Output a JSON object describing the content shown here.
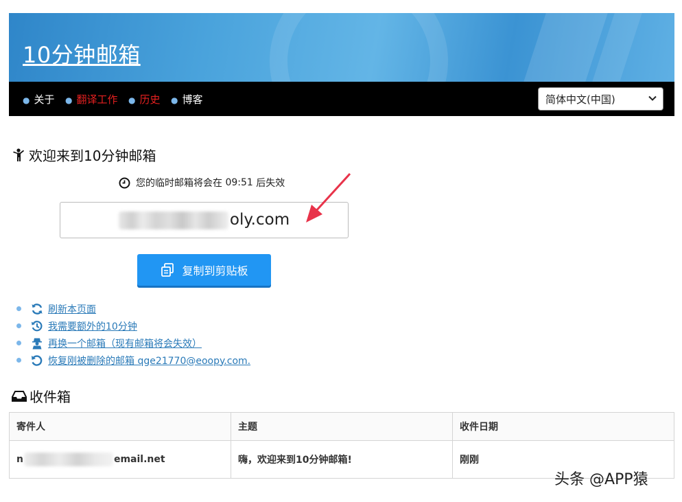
{
  "header": {
    "site_title": "10分钟邮箱"
  },
  "nav": {
    "items": [
      {
        "label": "关于",
        "color": "#ffffff"
      },
      {
        "label": "翻译工作",
        "color": "#e62020"
      },
      {
        "label": "历史",
        "color": "#e62020"
      },
      {
        "label": "博客",
        "color": "#ffffff"
      }
    ],
    "language": {
      "selected": "简体中文(中国)"
    }
  },
  "welcome": {
    "title": "欢迎来到10分钟邮箱"
  },
  "expire": {
    "prefix": "您的临时邮箱将会在",
    "time": "09:51",
    "suffix": "后失效"
  },
  "email": {
    "visible_part": "oly.com"
  },
  "copy_button": {
    "label": "复制到剪贴板"
  },
  "actions": [
    {
      "label": "刷新本页面",
      "icon": "refresh-icon"
    },
    {
      "label": "我需要额外的10分钟",
      "icon": "history-plus-icon"
    },
    {
      "label": "再换一个邮箱（现有邮箱将会失效）",
      "icon": "user-secret-icon"
    },
    {
      "label": "恢复刚被删除的邮箱 qge21770@eoopy.com.",
      "icon": "undo-icon"
    }
  ],
  "inbox": {
    "title": "收件箱",
    "columns": [
      "寄件人",
      "主题",
      "收件日期"
    ],
    "rows": [
      {
        "sender_start": "n",
        "sender_end": "email.net",
        "subject": "嗨，欢迎来到10分钟邮箱!",
        "date": "刚刚"
      }
    ]
  },
  "watermark": "头条 @APP猿",
  "colors": {
    "accent": "#2196f3",
    "nav_bg": "#000000",
    "link": "#2a7ab8",
    "arrow": "#e8334a"
  }
}
